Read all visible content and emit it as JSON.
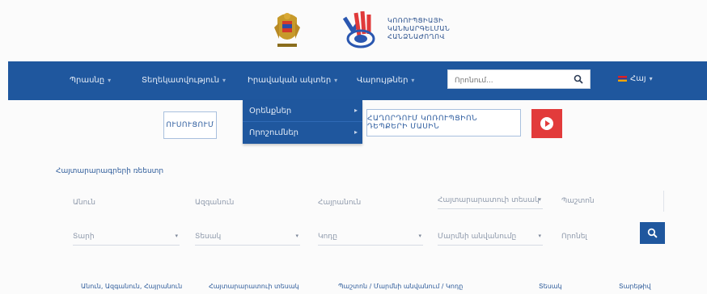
{
  "header": {
    "logo_lines": [
      "ԿՈՌՈՒՊՑԻԱՅԻ",
      "ԿԱՆԽԱՐԳԵԼՄԱՆ",
      "ՀԱՆՁՆԱԺՈՂՈՎ"
    ]
  },
  "nav": {
    "items": [
      {
        "label": "Պրասնը"
      },
      {
        "label": "Տեղեկատվություն"
      },
      {
        "label": "Իրավական ակտեր"
      },
      {
        "label": "Վարույթներ"
      }
    ],
    "search_placeholder": "Որոնում...",
    "language": "Հայ"
  },
  "dropdown": {
    "items": [
      "Օրենքներ",
      "Որոշումներ"
    ]
  },
  "buttons": {
    "left": "ՈՒՍՈՒՑՈՒՄ",
    "right": "ՀԱՂՈՐԴՈՒՄ ԿՈՌՈՒՊՑԻՈՆ ԴԵՊՔԵՐԻ ՄԱՍԻՆ"
  },
  "filter": {
    "title": "Հայտարարագրերի ռեեստր",
    "row1": [
      "Անուն",
      "Ազգանուն",
      "Հայրանուն",
      "Հայտարարատուի տեսակ",
      "Պաշտոն"
    ],
    "row2": [
      "Տարի",
      "Տեսակ",
      "Կոդը",
      "Մարմնի անվանումը",
      "Որոնել"
    ]
  },
  "table": {
    "headers": [
      "Անուն, Ազգանուն, Հայրանուն",
      "Հայտարարատուի տեսակ",
      "Պաշտոն / Մարմնի անվանում / Կոդը",
      "Տեսակ",
      "Տարեթիվ"
    ]
  },
  "colors": {
    "nav_bg": "#1f579e",
    "accent_red": "#e23b3b",
    "page_bg": "#fbfbfb"
  },
  "icons": [
    "coat-of-arms-icon",
    "commission-logo-icon",
    "search-icon",
    "flag-icon",
    "chevron-down-icon",
    "chevron-right-icon",
    "play-icon"
  ]
}
